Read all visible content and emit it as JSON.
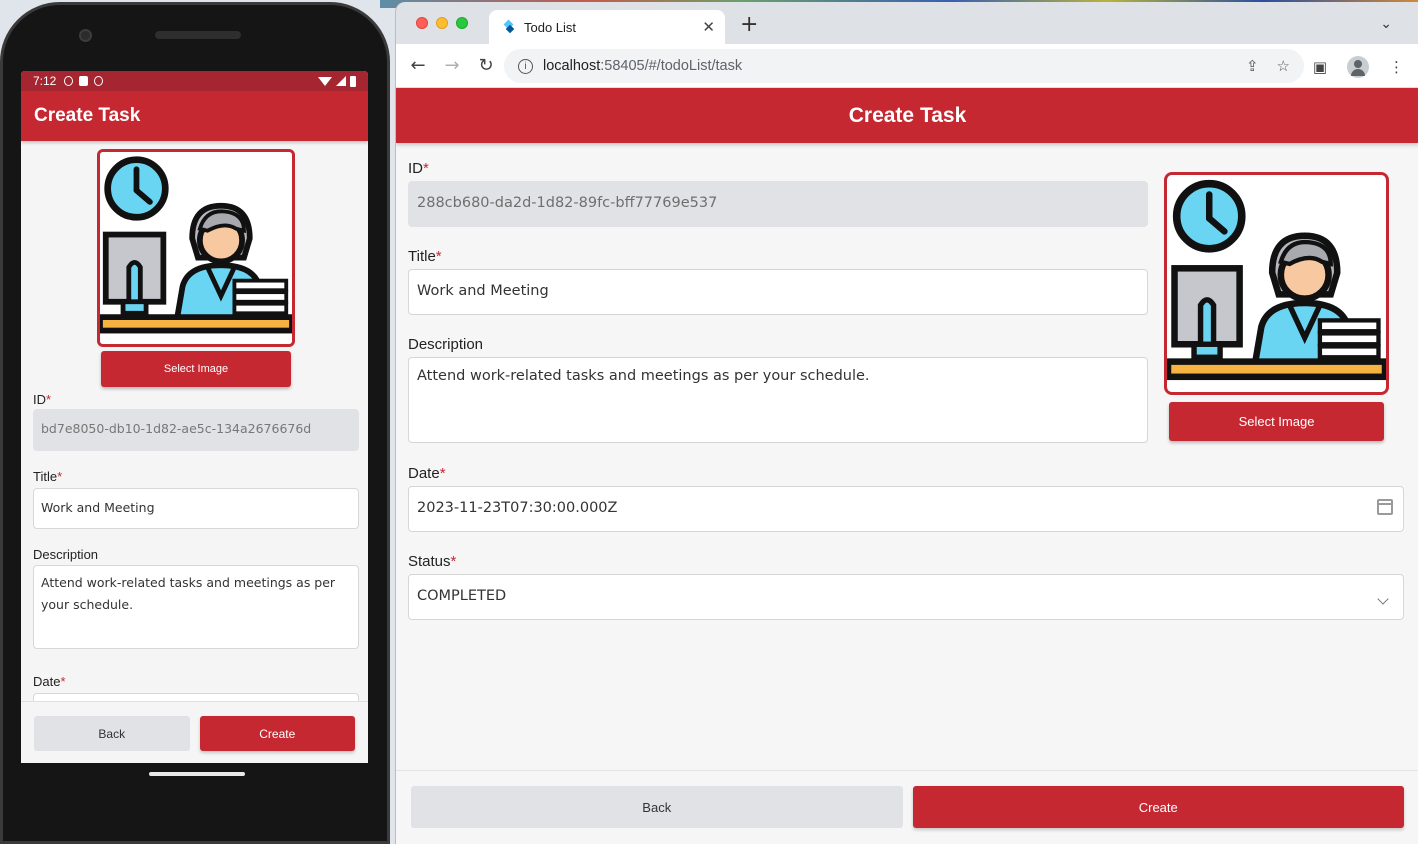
{
  "mobile": {
    "status": {
      "time": "7:12"
    },
    "app_bar_title": "Create Task",
    "select_image_label": "Select Image",
    "fields": {
      "id_label": "ID",
      "id_value": "bd7e8050-db10-1d82-ae5c-134a2676676d",
      "title_label": "Title",
      "title_value": "Work and Meeting",
      "description_label": "Description",
      "description_value": "Attend work-related tasks and meetings as per your schedule.",
      "date_label": "Date"
    },
    "required_mark": "*",
    "back_label": "Back",
    "create_label": "Create"
  },
  "browser": {
    "tab_title": "Todo List",
    "url_host": "localhost",
    "url_path": ":58405/#/todoList/task",
    "icons": [
      "back-arrow-icon",
      "forward-arrow-icon",
      "reload-icon",
      "info-icon",
      "share-icon",
      "star-icon",
      "sidebar-icon",
      "profile-icon",
      "menu-dots-icon"
    ]
  },
  "web": {
    "app_bar_title": "Create Task",
    "select_image_label": "Select Image",
    "fields": {
      "id_label": "ID",
      "id_value": "288cb680-da2d-1d82-89fc-bff77769e537",
      "title_label": "Title",
      "title_value": "Work and Meeting",
      "description_label": "Description",
      "description_value": "Attend work-related tasks and meetings as per your schedule.",
      "date_label": "Date",
      "date_value": "2023-11-23T07:30:00.000Z",
      "status_label": "Status",
      "status_value": "COMPLETED"
    },
    "required_mark": "*",
    "back_label": "Back",
    "create_label": "Create"
  },
  "colors": {
    "primary": "#c62832",
    "status_bar": "#a52530",
    "readonly_field": "#e1e2e5"
  }
}
